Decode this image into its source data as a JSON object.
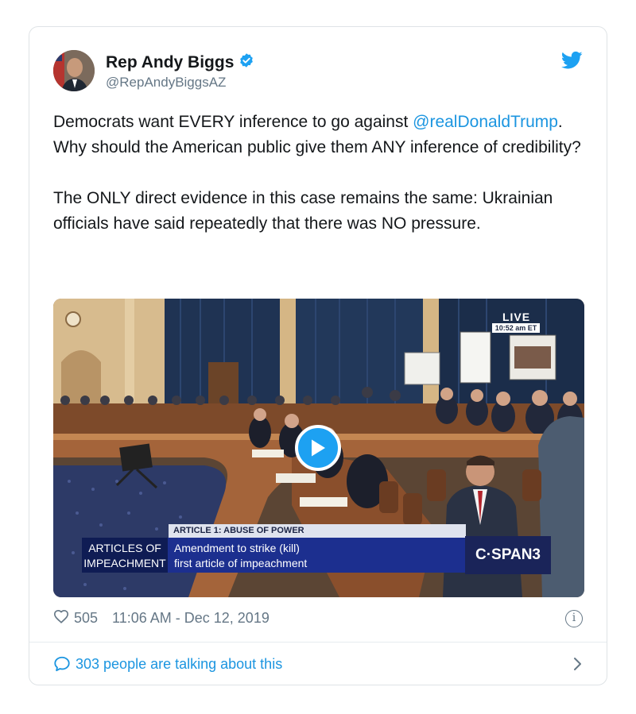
{
  "tweet": {
    "author_name": "Rep Andy Biggs",
    "author_handle": "@RepAndyBiggsAZ",
    "text_line1_pre": "Democrats want EVERY inference to go against ",
    "mention": "@realDonaldTrump",
    "text_line1_post": ". Why should the American public give them ANY inference of credibility?",
    "text_para2": "The ONLY direct evidence in this case remains the same: Ukrainian officials have said repeatedly that there was NO pressure.",
    "likes": "505",
    "timestamp": "11:06 AM - Dec 12, 2019",
    "talking": "303 people are talking about this"
  },
  "media": {
    "live_label": "LIVE",
    "live_time": "10:52 am ET",
    "chyron_top": "ARTICLE 1: ABUSE OF POWER",
    "chyron_left_line1": "ARTICLES OF",
    "chyron_left_line2": "IMPEACHMENT",
    "chyron_main_line1": "Amendment to strike (kill)",
    "chyron_main_line2": "first article of impeachment",
    "network": "C·SPAN3"
  },
  "icons": {
    "verified": "verified-badge-icon",
    "brand": "twitter-bird-icon",
    "like": "heart-icon",
    "info": "info-icon",
    "reply": "speech-bubble-icon",
    "chevron": "chevron-right-icon"
  },
  "colors": {
    "accent": "#1da1f2",
    "link": "#1b95e0",
    "text": "#14171a",
    "muted": "#657786"
  }
}
